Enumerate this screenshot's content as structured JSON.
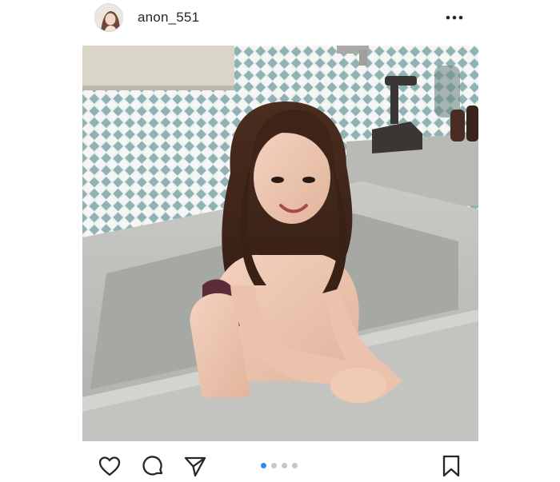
{
  "post": {
    "username": "anon_551",
    "photo_alt": "Post photo"
  },
  "icons": {
    "more": "more-options-icon",
    "like": "heart-icon",
    "comment": "comment-bubble-icon",
    "share": "paper-plane-icon",
    "save": "bookmark-icon"
  },
  "carousel": {
    "total": 4,
    "active_index": 0
  },
  "colors": {
    "active_dot": "#2e8bf0",
    "inactive_dot": "#c7c7c7",
    "text": "#262626"
  }
}
